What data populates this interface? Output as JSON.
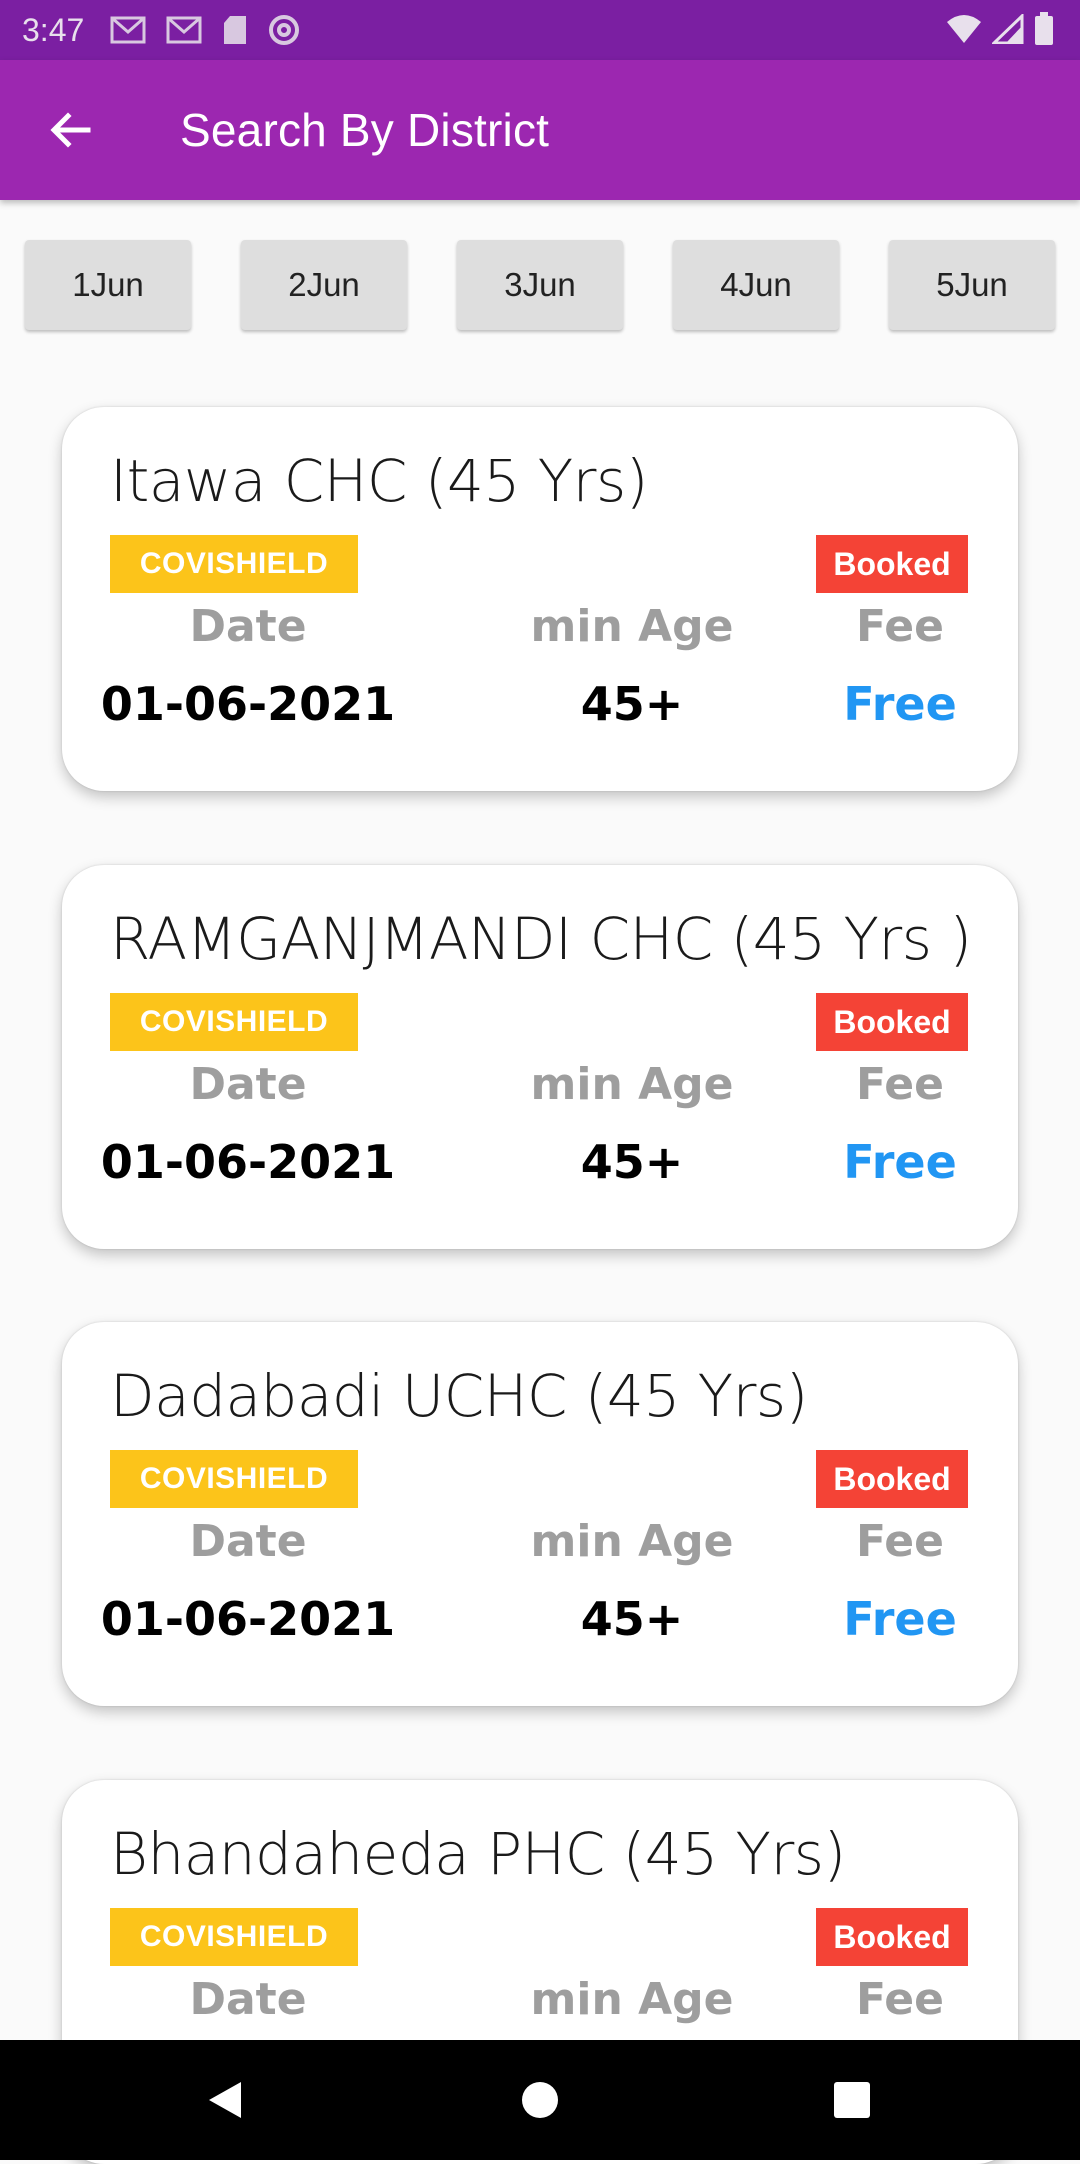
{
  "status_bar": {
    "time": "3:47",
    "icons": [
      "gmail-icon",
      "gmail-icon",
      "sd-card-icon",
      "at-sign-icon"
    ],
    "right_icons": [
      "wifi-icon",
      "signal-icon",
      "battery-icon"
    ]
  },
  "app_bar": {
    "title": "Search By District",
    "back_icon": "arrow-left-icon"
  },
  "date_tabs": [
    "1Jun",
    "2Jun",
    "3Jun",
    "4Jun",
    "5Jun"
  ],
  "cards": [
    {
      "title": "Itawa CHC (45 Yrs)",
      "vaccine": "COVISHIELD",
      "status": "Booked",
      "labels": {
        "date": "Date",
        "age": "min Age",
        "fee": "Fee"
      },
      "date": "01-06-2021",
      "min_age": "45+",
      "fee": "Free"
    },
    {
      "title": "RAMGANJMANDI CHC (45 Yrs )",
      "vaccine": "COVISHIELD",
      "status": "Booked",
      "labels": {
        "date": "Date",
        "age": "min Age",
        "fee": "Fee"
      },
      "date": "01-06-2021",
      "min_age": "45+",
      "fee": "Free"
    },
    {
      "title": "Dadabadi UCHC (45 Yrs)",
      "vaccine": "COVISHIELD",
      "status": "Booked",
      "labels": {
        "date": "Date",
        "age": "min Age",
        "fee": "Fee"
      },
      "date": "01-06-2021",
      "min_age": "45+",
      "fee": "Free"
    },
    {
      "title": "Bhandaheda PHC (45 Yrs)",
      "vaccine": "COVISHIELD",
      "status": "Booked",
      "labels": {
        "date": "Date",
        "age": "min Age",
        "fee": "Fee"
      }
    }
  ],
  "colors": {
    "status_bar": "#7b1fa2",
    "app_bar": "#9c27b0",
    "vaccine_badge": "#fcc41a",
    "booked_badge": "#f44336",
    "fee_text": "#2196f3",
    "label_text": "#9e9e9e"
  },
  "nav_bar": [
    "back-triangle-icon",
    "home-circle-icon",
    "recents-square-icon"
  ]
}
